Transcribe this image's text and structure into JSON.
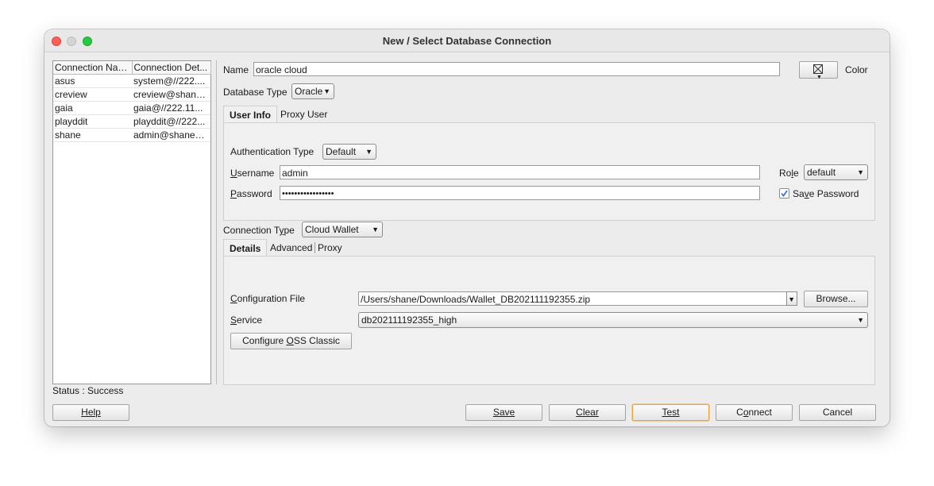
{
  "window": {
    "title": "New / Select Database Connection"
  },
  "connections": {
    "headers": [
      "Connection Name",
      "Connection Det..."
    ],
    "rows": [
      [
        "asus",
        "system@//222...."
      ],
      [
        "creview",
        "creview@shane_..."
      ],
      [
        "gaia",
        "gaia@//222.11..."
      ],
      [
        "playddit",
        "playddit@//222..."
      ],
      [
        "shane",
        "admin@shane_h..."
      ]
    ]
  },
  "form": {
    "name_label": "Name",
    "name_value": "oracle cloud",
    "color_label": "Color",
    "db_type_label": "Database Type",
    "db_type_value": "Oracle",
    "tabs": [
      "User Info",
      "Proxy User"
    ],
    "auth_type_label": "Authentication Type",
    "auth_type_value": "Default",
    "username_label_u": "U",
    "username_label_rest": "sername",
    "username_value": "admin",
    "password_label_u": "P",
    "password_label_rest": "assword",
    "password_value": "•••••••••••••••••",
    "role_label_a": "Ro",
    "role_label_u": "l",
    "role_label_b": "e",
    "role_value": "default",
    "save_password_label_a": "Sa",
    "save_password_label_u": "v",
    "save_password_label_b": "e Password",
    "save_password_checked": true,
    "conn_type_label_a": "Connection T",
    "conn_type_label_u": "y",
    "conn_type_label_b": "pe",
    "conn_type_value": "Cloud Wallet",
    "detail_tabs": [
      "Details",
      "Advanced",
      "Proxy"
    ],
    "config_file_label_u": "C",
    "config_file_label_rest": "onfiguration File",
    "config_file_value": "/Users/shane/Downloads/Wallet_DB202111192355.zip",
    "browse_label": "Browse...",
    "service_label_u": "S",
    "service_label_rest": "ervice",
    "service_value": "db202111192355_high",
    "configure_oss_a": "Configure ",
    "configure_oss_u": "O",
    "configure_oss_b": "SS Classic"
  },
  "status": "Status : Success",
  "buttons": {
    "help": "Help",
    "save": "Save",
    "clear": "Clear",
    "test": "Test",
    "connect": "Connect",
    "cancel": "Cancel"
  },
  "colors": {
    "close": "#fe5f57",
    "minimize": "#d4d4d4",
    "zoom": "#28c840",
    "focus": "#f0a33c",
    "check": "#2a6fd6"
  }
}
